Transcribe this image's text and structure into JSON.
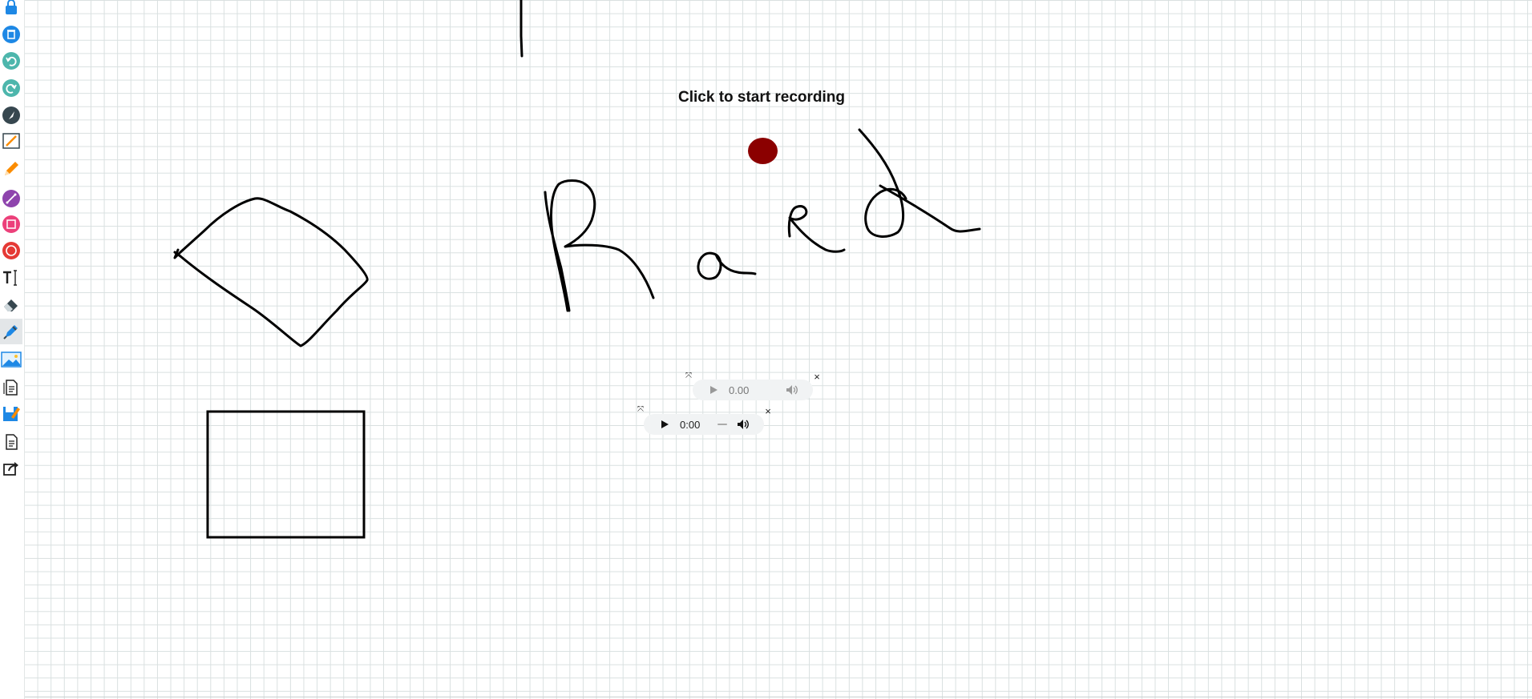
{
  "recorder": {
    "prompt": "Click to start recording",
    "button_color": "#8b0000"
  },
  "audio_players": [
    {
      "time": "0.00",
      "state": "disabled",
      "drag_glyph": "⤧",
      "close_glyph": "×"
    },
    {
      "time": "0:00",
      "state": "enabled",
      "drag_glyph": "⤧",
      "close_glyph": "×"
    }
  ],
  "toolbar": {
    "tools": [
      {
        "name": "lock-icon",
        "color": "#1e88e5"
      },
      {
        "name": "trash-icon",
        "color": "#1e88e5"
      },
      {
        "name": "undo-icon",
        "color": "#4db6ac"
      },
      {
        "name": "redo-icon",
        "color": "#4db6ac"
      },
      {
        "name": "pointer-icon",
        "color": "#37474f"
      },
      {
        "name": "ruler-pencil-icon",
        "color": "#37474f"
      },
      {
        "name": "pencil-icon",
        "color": "#fb8c00"
      },
      {
        "name": "line-icon",
        "color": "#8e44ad"
      },
      {
        "name": "rectangle-icon",
        "color": "#ec407a"
      },
      {
        "name": "circle-icon",
        "color": "#e53935"
      },
      {
        "name": "text-icon",
        "color": "#222222"
      },
      {
        "name": "eraser-icon",
        "color": "#37474f"
      },
      {
        "name": "pen-icon",
        "color": "#1e88e5",
        "active": true
      },
      {
        "name": "image-icon",
        "color": "#1e88e5"
      },
      {
        "name": "document-icon",
        "color": "#222222"
      },
      {
        "name": "save-icon",
        "color": "#1e88e5"
      },
      {
        "name": "page-icon",
        "color": "#222222"
      },
      {
        "name": "share-icon",
        "color": "#222222"
      }
    ]
  },
  "colors": {
    "grid_line": "#d9e0e0",
    "ink": "#000000",
    "player_bg": "#f1f3f4"
  }
}
